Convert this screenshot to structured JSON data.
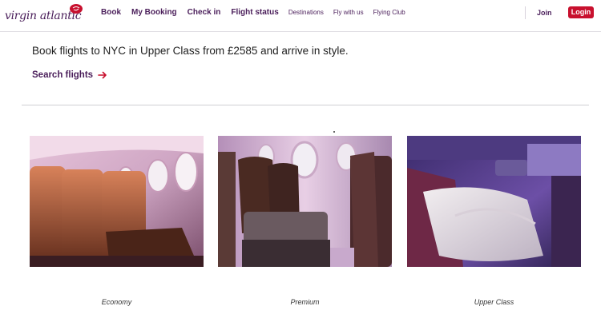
{
  "brand": {
    "name": "virgin atlantic",
    "badge": "Virgin"
  },
  "nav": {
    "items": [
      {
        "label": "Book"
      },
      {
        "label": "My Booking"
      },
      {
        "label": "Check in"
      },
      {
        "label": "Flight status"
      },
      {
        "label": "Destinations"
      },
      {
        "label": "Fly with us"
      },
      {
        "label": "Flying Club"
      }
    ],
    "join_label": "Join",
    "login_label": "Login"
  },
  "promo": {
    "headline": "Book flights to NYC in Upper Class from £2585 and arrive in style.",
    "search_label": "Search flights"
  },
  "cabins": [
    {
      "label": "Economy",
      "image": "economy-seats-photo"
    },
    {
      "label": "Premium",
      "image": "premium-seats-photo"
    },
    {
      "label": "Upper Class",
      "image": "upper-class-suite-photo"
    }
  ],
  "colors": {
    "brand_purple": "#4a1e5a",
    "login_red": "#c8102e",
    "text_dark": "#1f1f1f"
  }
}
